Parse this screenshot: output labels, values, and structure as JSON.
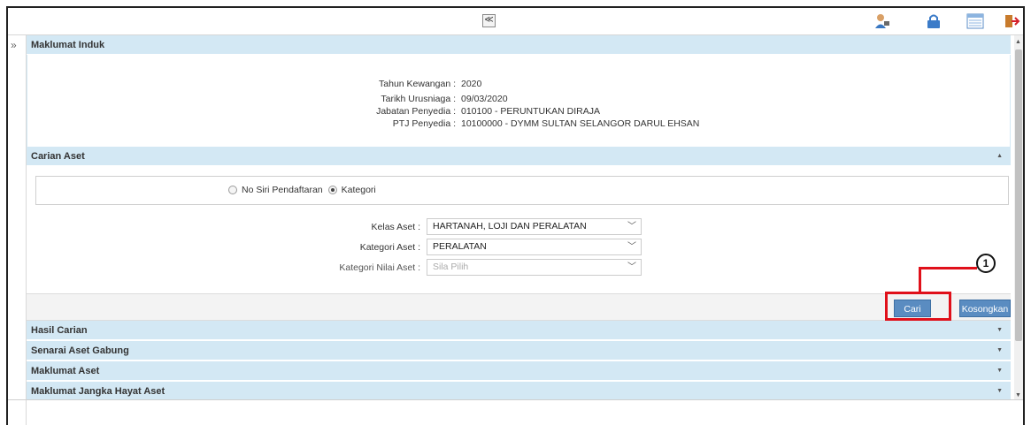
{
  "toolbar": {
    "collapse_glyph": "≪",
    "icons": [
      "user-icon",
      "lock-icon",
      "list-icon",
      "exit-icon"
    ]
  },
  "sidebar": {
    "expand_glyph": "»"
  },
  "sections": {
    "maklumat_induk": {
      "title": "Maklumat Induk",
      "rows": [
        {
          "label": "Tahun Kewangan :",
          "value": "2020"
        },
        {
          "label": "Tarikh Urusniaga :",
          "value": "09/03/2020"
        },
        {
          "label": "Jabatan Penyedia :",
          "value": "010100 - PERUNTUKAN DIRAJA"
        },
        {
          "label": "PTJ Penyedia :",
          "value": "10100000 - DYMM SULTAN SELANGOR DARUL EHSAN"
        }
      ]
    },
    "carian_aset": {
      "title": "Carian Aset",
      "radio_options": [
        {
          "label": "No Siri Pendaftaran",
          "checked": false
        },
        {
          "label": "Kategori",
          "checked": true
        }
      ],
      "fields": [
        {
          "label": "Kelas Aset :",
          "value": "HARTANAH, LOJI DAN PERALATAN"
        },
        {
          "label": "Kategori Aset :",
          "value": "PERALATAN"
        },
        {
          "label": "Kategori Nilai Aset :",
          "value": "Sila Pilih"
        }
      ],
      "buttons": {
        "search": "Cari",
        "clear": "Kosongkan"
      }
    },
    "collapsed": [
      {
        "title": "Hasil Carian"
      },
      {
        "title": "Senarai Aset Gabung"
      },
      {
        "title": "Maklumat Aset"
      },
      {
        "title": "Maklumat Jangka Hayat Aset"
      }
    ]
  },
  "callout": {
    "number": "1",
    "color": "#e0101a"
  },
  "colors": {
    "section_header": "#d3e8f4",
    "button": "#5a8cc1"
  }
}
